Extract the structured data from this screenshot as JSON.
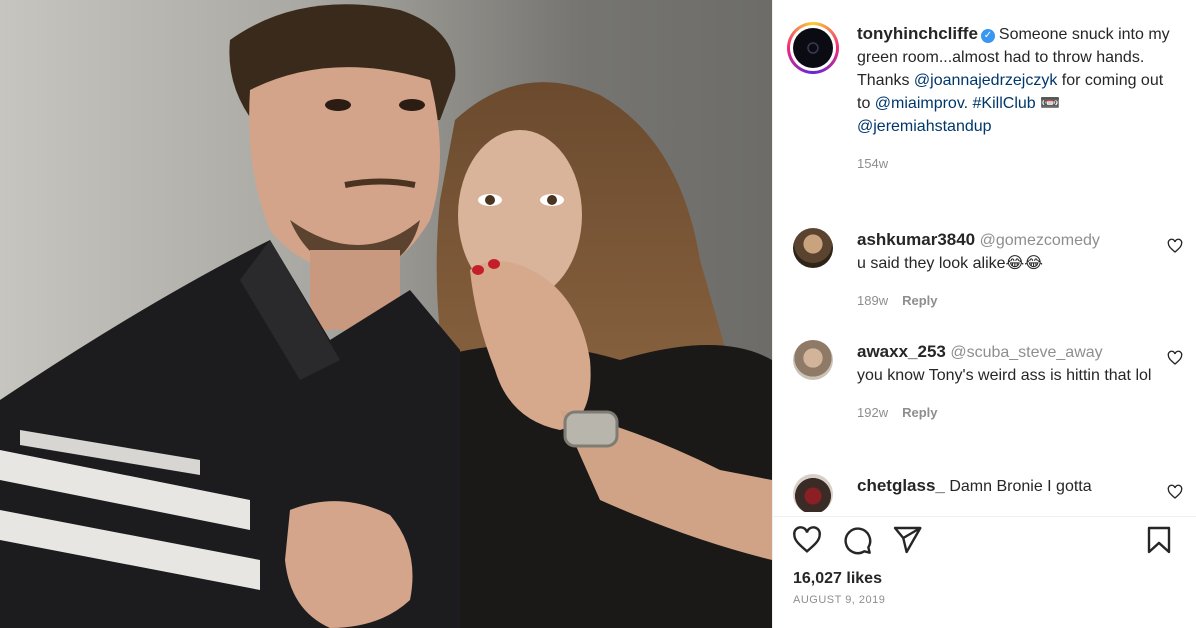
{
  "post": {
    "username": "tonyhinchcliffe",
    "caption_part1": "Someone snuck into my green room...almost had to throw hands. Thanks ",
    "mention1": "@joannajedrzejczyk",
    "caption_part2": " for coming out to ",
    "mention2": "@miaimprov",
    "caption_part3": ". ",
    "hashtag": "#KillClub",
    "caption_part4": " 📼 ",
    "mention3": "@jeremiahstandup",
    "time": "154w"
  },
  "comments": [
    {
      "user": "ashkumar3840",
      "mention": "@gomezcomedy",
      "text": "u said they look alike😂😂",
      "time": "189w",
      "reply": "Reply"
    },
    {
      "user": "awaxx_253",
      "mention": "@scuba_steve_away",
      "text": "you know Tony's weird ass is hittin that lol",
      "time": "192w",
      "reply": "Reply"
    },
    {
      "user": "chetglass_",
      "mention": "",
      "text": "Damn Bronie I gotta",
      "time": "",
      "reply": ""
    }
  ],
  "footer": {
    "likes": "16,027 likes",
    "date": "AUGUST 9, 2019"
  },
  "icons": {
    "like": "heart-icon",
    "comment": "comment-icon",
    "share": "paper-plane-icon",
    "save": "bookmark-icon"
  }
}
